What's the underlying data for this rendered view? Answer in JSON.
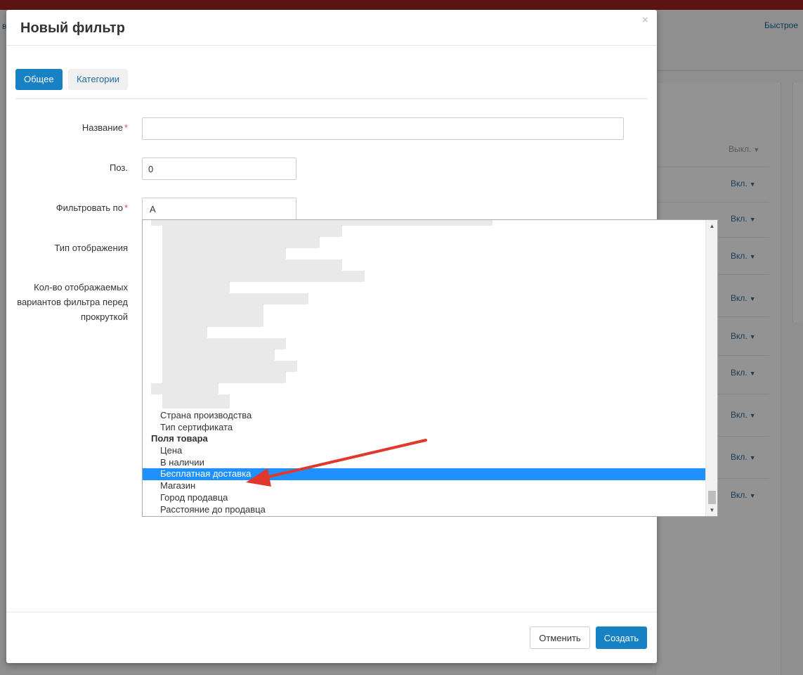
{
  "background": {
    "left_link": "в",
    "quick_link": "Быстрое",
    "toggles": [
      {
        "label": "Выкл.",
        "state": "off"
      },
      {
        "label": "Вкл.",
        "state": "on"
      },
      {
        "label": "Вкл.",
        "state": "on"
      },
      {
        "label": "Вкл.",
        "state": "on"
      },
      {
        "label": "Вкл.",
        "state": "on"
      },
      {
        "label": "Вкл.",
        "state": "on"
      },
      {
        "label": "Вкл.",
        "state": "on"
      },
      {
        "label": "Вкл.",
        "state": "on"
      },
      {
        "label": "Вкл.",
        "state": "on"
      },
      {
        "label": "Вкл.",
        "state": "on"
      }
    ]
  },
  "modal": {
    "title": "Новый фильтр",
    "close_glyph": "×",
    "tabs": [
      {
        "label": "Общее",
        "active": true
      },
      {
        "label": "Категории",
        "active": false
      }
    ],
    "fields": {
      "name_label": "Название",
      "name_value": "",
      "position_label": "Поз.",
      "position_value": "0",
      "filter_by_label": "Фильтровать по",
      "filter_by_value": "А",
      "display_type_label": "Тип отображения",
      "variants_label": "Кол-во отображаемых вариантов фильтра перед прокруткой",
      "required_mark": "*"
    },
    "dropdown": {
      "options": [
        {
          "kind": "option",
          "label": "Страна производства"
        },
        {
          "kind": "option",
          "label": "Тип сертификата"
        },
        {
          "kind": "group",
          "label": "Поля товара"
        },
        {
          "kind": "option",
          "label": "Цена"
        },
        {
          "kind": "option",
          "label": "В наличии"
        },
        {
          "kind": "option",
          "label": "Бесплатная доставка",
          "selected": true
        },
        {
          "kind": "option",
          "label": "Магазин"
        },
        {
          "kind": "option",
          "label": "Город продавца"
        },
        {
          "kind": "option",
          "label": "Расстояние до продавца"
        }
      ],
      "scroll_up_glyph": "▲",
      "scroll_down_glyph": "▼"
    },
    "footer": {
      "cancel_label": "Отменить",
      "create_label": "Создать"
    }
  },
  "colors": {
    "primary": "#1682c4",
    "selected_option": "#1e90ff",
    "required": "#d9534f",
    "annotation_arrow": "#e0382d",
    "header_bar": "#5c1413"
  }
}
